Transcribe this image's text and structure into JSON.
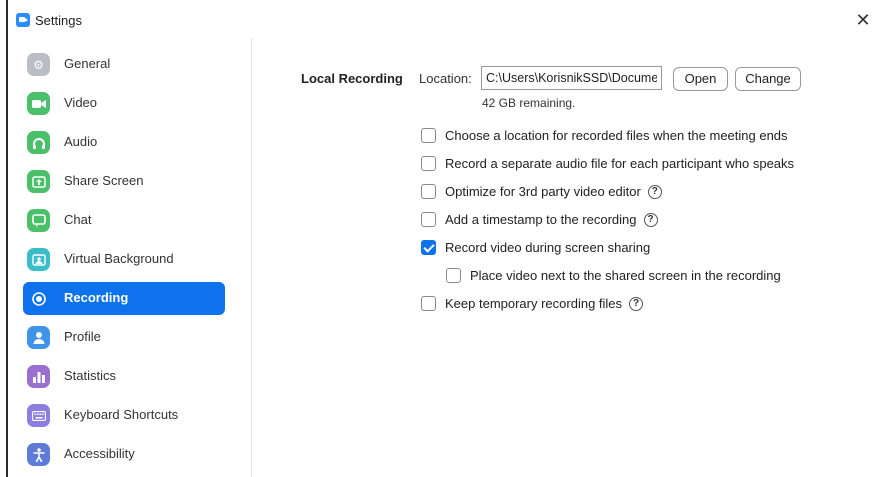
{
  "window": {
    "title": "Settings",
    "close_icon": "close-icon"
  },
  "sidebar": {
    "items": [
      {
        "label": "General",
        "icon": "gear-icon"
      },
      {
        "label": "Video",
        "icon": "video-camera-icon"
      },
      {
        "label": "Audio",
        "icon": "headphones-icon"
      },
      {
        "label": "Share Screen",
        "icon": "share-screen-icon"
      },
      {
        "label": "Chat",
        "icon": "chat-bubble-icon"
      },
      {
        "label": "Virtual Background",
        "icon": "person-background-icon"
      },
      {
        "label": "Recording",
        "icon": "record-icon",
        "active": true
      },
      {
        "label": "Profile",
        "icon": "user-icon"
      },
      {
        "label": "Statistics",
        "icon": "bar-chart-icon"
      },
      {
        "label": "Keyboard Shortcuts",
        "icon": "keyboard-icon"
      },
      {
        "label": "Accessibility",
        "icon": "accessibility-icon"
      }
    ]
  },
  "recording": {
    "section_title": "Local Recording",
    "location_label": "Location:",
    "location_value": "C:\\Users\\KorisnikSSD\\Documents\\Zoom",
    "open_label": "Open",
    "change_label": "Change",
    "remaining": "42 GB remaining.",
    "options": [
      {
        "label": "Choose a location for recorded files when the meeting ends",
        "checked": false,
        "help": false
      },
      {
        "label": "Record a separate audio file for each participant who speaks",
        "checked": false,
        "help": false
      },
      {
        "label": "Optimize for 3rd party video editor",
        "checked": false,
        "help": true
      },
      {
        "label": "Add a timestamp to the recording",
        "checked": false,
        "help": true
      },
      {
        "label": "Record video during screen sharing",
        "checked": true,
        "help": false
      },
      {
        "label": "Place video next to the shared screen in the recording",
        "checked": false,
        "help": false
      },
      {
        "label": "Keep temporary recording files",
        "checked": false,
        "help": true
      }
    ],
    "help_glyph": "?"
  },
  "colors": {
    "accent": "#0e72ed",
    "green": "#4cbf6b"
  }
}
